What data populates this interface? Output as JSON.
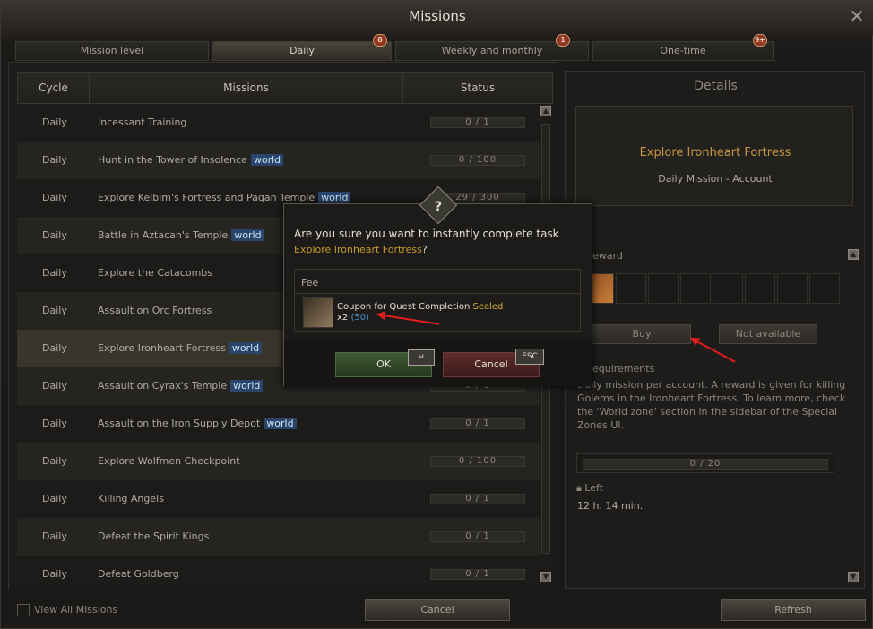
{
  "window": {
    "title": "Missions",
    "close_glyph": "✕"
  },
  "tabs": [
    {
      "label": "Mission level",
      "badge": ""
    },
    {
      "label": "Daily",
      "badge": "8"
    },
    {
      "label": "Weekly and monthly",
      "badge": "1"
    },
    {
      "label": "One-time",
      "badge": "9+"
    }
  ],
  "table": {
    "headers": {
      "cycle": "Cycle",
      "missions": "Missions",
      "status": "Status"
    },
    "world_tag": "world",
    "rows": [
      {
        "cycle": "Daily",
        "mission": "Incessant Training",
        "world": false,
        "status": "0 / 1"
      },
      {
        "cycle": "Daily",
        "mission": "Hunt in the Tower of Insolence",
        "world": true,
        "status": "0 / 100"
      },
      {
        "cycle": "Daily",
        "mission": "Explore Kelbim's Fortress and Pagan Temple",
        "world": true,
        "status": "29 / 300"
      },
      {
        "cycle": "Daily",
        "mission": "Battle in Aztacan's Temple",
        "world": true,
        "status": ""
      },
      {
        "cycle": "Daily",
        "mission": "Explore the Catacombs",
        "world": false,
        "status": ""
      },
      {
        "cycle": "Daily",
        "mission": "Assault on Orc Fortress",
        "world": false,
        "status": ""
      },
      {
        "cycle": "Daily",
        "mission": "Explore Ironheart Fortress",
        "world": true,
        "status": ""
      },
      {
        "cycle": "Daily",
        "mission": "Assault on Cyrax's Temple",
        "world": true,
        "status": "0 / 1"
      },
      {
        "cycle": "Daily",
        "mission": "Assault on the Iron Supply Depot",
        "world": true,
        "status": "0 / 1"
      },
      {
        "cycle": "Daily",
        "mission": "Explore Wolfmen Checkpoint",
        "world": false,
        "status": "0 / 100"
      },
      {
        "cycle": "Daily",
        "mission": "Killing Angels",
        "world": false,
        "status": "0 / 1"
      },
      {
        "cycle": "Daily",
        "mission": "Defeat the Spirit Kings",
        "world": false,
        "status": "0 / 1"
      },
      {
        "cycle": "Daily",
        "mission": "Defeat Goldberg",
        "world": false,
        "status": "0 / 1"
      }
    ]
  },
  "details": {
    "title": "Details",
    "mission_name": "Explore Ironheart Fortress",
    "mission_type": "Daily Mission  -  Account",
    "reward_label": "eward",
    "buy_label": "Buy",
    "not_available_label": "Not available",
    "requirements_label": "equirements",
    "requirements_text": "Daily mission per account. A reward is given for killing Golems in the Ironheart Fortress. To learn more, check the 'World zone' section in the sidebar of the Special Zones UI.",
    "progress": "0 / 20",
    "left_label": "Left",
    "left_value": "12 h. 14 min."
  },
  "bottom": {
    "view_all_label": "View All Missions",
    "cancel_label": "Cancel",
    "refresh_label": "Refresh"
  },
  "dialog": {
    "icon": "?",
    "question": "Are you sure you want to instantly complete task",
    "target": "Explore Ironheart Fortress",
    "target_suffix": "?",
    "fee_label": "Fee",
    "item_name": "Coupon for Quest Completion",
    "item_tag": "Sealed",
    "item_qty": "x2",
    "item_owned": "(50)",
    "ok_label": "OK",
    "cancel_label": "Cancel",
    "ok_hotkey": "↵",
    "cancel_hotkey": "ESC"
  },
  "colors": {
    "accent_gold": "#c69643",
    "world_tag_bg": "#29456a",
    "annotation_red": "#e01d1d"
  }
}
